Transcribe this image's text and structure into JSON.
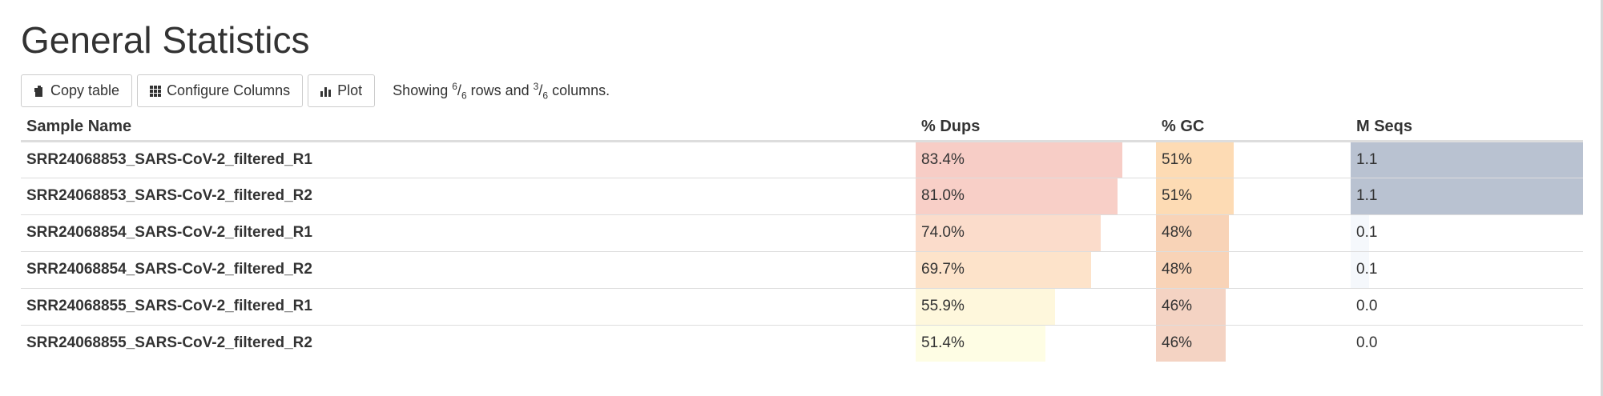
{
  "title": "General Statistics",
  "toolbar": {
    "copy_label": "Copy table",
    "configure_label": "Configure Columns",
    "plot_label": "Plot",
    "showing_prefix": "Showing ",
    "rows_shown": "6",
    "rows_total": "6",
    "rows_text": " rows and ",
    "cols_shown": "3",
    "cols_total": "6",
    "cols_text": " columns."
  },
  "table": {
    "headers": [
      "Sample Name",
      "% Dups",
      "% GC",
      "M Seqs"
    ],
    "rows": [
      {
        "name": "SRR24068853_SARS-CoV-2_filtered_R1",
        "dups": "83.4%",
        "gc": "51%",
        "seqs": "1.1",
        "dups_fill": 0.86,
        "gc_fill": 0.4,
        "seqs_fill": 1.0,
        "dups_color": "#f7cdc6",
        "gc_color": "#fddbb4",
        "seqs_color": "#b9c2d1"
      },
      {
        "name": "SRR24068853_SARS-CoV-2_filtered_R2",
        "dups": "81.0%",
        "gc": "51%",
        "seqs": "1.1",
        "dups_fill": 0.84,
        "gc_fill": 0.4,
        "seqs_fill": 1.0,
        "dups_color": "#f8cfc7",
        "gc_color": "#fddbb4",
        "seqs_color": "#b9c2d1"
      },
      {
        "name": "SRR24068854_SARS-CoV-2_filtered_R1",
        "dups": "74.0%",
        "gc": "48%",
        "seqs": "0.1",
        "dups_fill": 0.77,
        "gc_fill": 0.375,
        "seqs_fill": 0.08,
        "dups_color": "#fbdccb",
        "gc_color": "#f8d3b7",
        "seqs_color": "#f5f8fc"
      },
      {
        "name": "SRR24068854_SARS-CoV-2_filtered_R2",
        "dups": "69.7%",
        "gc": "48%",
        "seqs": "0.1",
        "dups_fill": 0.73,
        "gc_fill": 0.375,
        "seqs_fill": 0.08,
        "dups_color": "#fde3ca",
        "gc_color": "#f8d3b7",
        "seqs_color": "#f5f8fc"
      },
      {
        "name": "SRR24068855_SARS-CoV-2_filtered_R1",
        "dups": "55.9%",
        "gc": "46%",
        "seqs": "0.0",
        "dups_fill": 0.58,
        "gc_fill": 0.36,
        "seqs_fill": 0.0,
        "dups_color": "#fef7dc",
        "gc_color": "#f4d3c3",
        "seqs_color": "#ffffff"
      },
      {
        "name": "SRR24068855_SARS-CoV-2_filtered_R2",
        "dups": "51.4%",
        "gc": "46%",
        "seqs": "0.0",
        "dups_fill": 0.54,
        "gc_fill": 0.36,
        "seqs_fill": 0.0,
        "dups_color": "#fefde4",
        "gc_color": "#f4d3c3",
        "seqs_color": "#ffffff"
      }
    ]
  },
  "icons": {
    "copy": "copy-icon",
    "configure": "grid-icon",
    "plot": "bar-chart-icon"
  }
}
